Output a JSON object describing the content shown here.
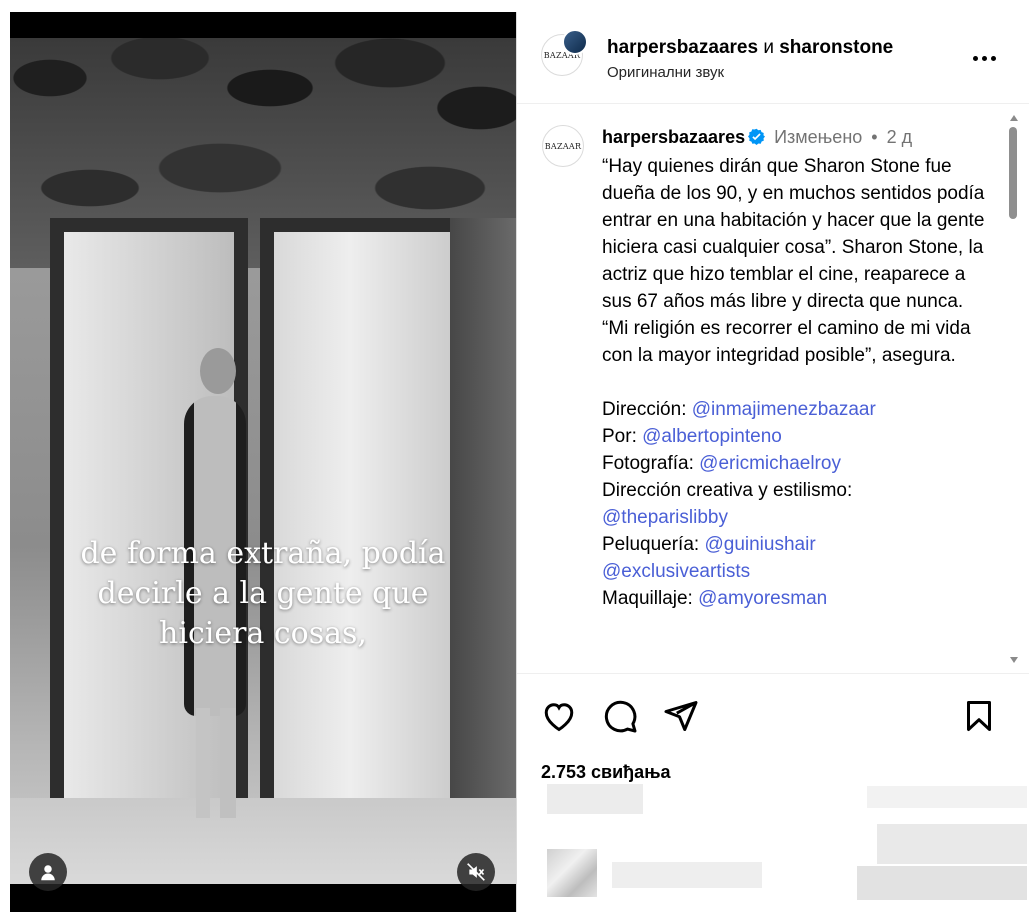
{
  "media": {
    "overlay_lines": [
      "de forma extraña, podía",
      "decirle a la gente que",
      "hiciera cosas,"
    ],
    "icons": {
      "tagged_users": "user-icon",
      "mute": "speaker-muted-icon"
    }
  },
  "header": {
    "avatar_text": "BAZAAR",
    "user1": "harpersbazaares",
    "conjunction": "и",
    "user2": "sharonstone",
    "audio": "Оригинални звук",
    "more_icon": "ellipsis-icon"
  },
  "caption": {
    "avatar_text": "BAZAAR",
    "username": "harpersbazaares",
    "edited": "Измењено",
    "dot": "•",
    "time": "2 д",
    "paragraph": "“Hay quienes dirán que Sharon Stone fue dueña de los 90, y en muchos sentidos podía entrar en una habitación y hacer que la gente hiciera casi cualquier cosa”. Sharon Stone, la actriz que hizo temblar el cine, reaparece a sus 67 años más libre y directa que nunca. “Mi religión es recorrer el camino de mi vida con la mayor integridad posible”, asegura.",
    "credits": [
      {
        "label": "Dirección:",
        "mention": "@inmajimenezbazaar"
      },
      {
        "label": "Por:",
        "mention": "@albertopinteno"
      },
      {
        "label": "Fotografía:",
        "mention": "@ericmichaelroy"
      },
      {
        "label": "Dirección creativa y estilismo:",
        "mention": ""
      },
      {
        "label": "",
        "mention": "@theparislibby"
      },
      {
        "label": "Peluquería:",
        "mention": "@guiniushair"
      },
      {
        "label": "",
        "mention": "@exclusiveartists"
      },
      {
        "label": "Maquillaje:",
        "mention": "@amyoresman"
      }
    ]
  },
  "actions": {
    "like_icon": "heart-icon",
    "comment_icon": "comment-icon",
    "share_icon": "send-icon",
    "save_icon": "bookmark-icon",
    "likes": "2.753 свиђања"
  },
  "colors": {
    "mention": "#4a5fd6",
    "verified": "#0095f6",
    "meta_gray": "#737373",
    "border": "#dbdbdb"
  }
}
